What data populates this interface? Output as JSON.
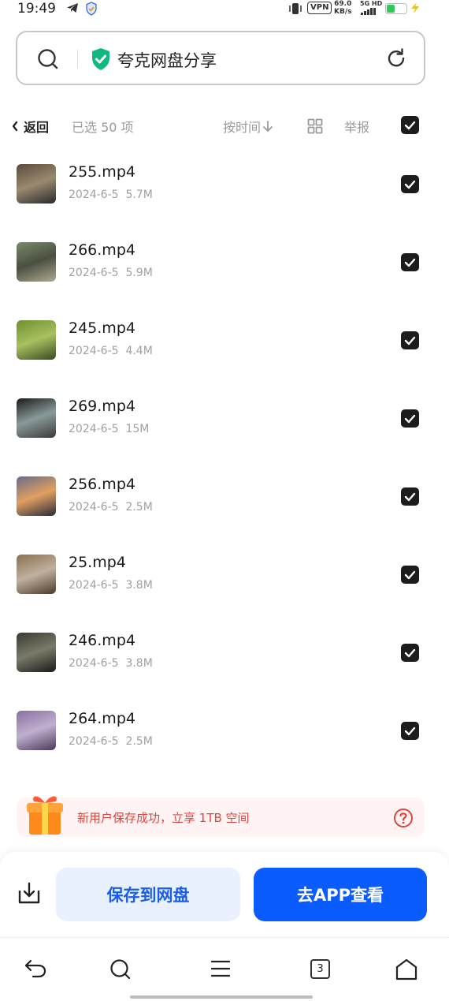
{
  "status_bar": {
    "time": "19:49",
    "vpn": "VPN",
    "speed_value": "69.0",
    "speed_unit": "KB/s",
    "network": "5G HD",
    "battery_level": 0.4
  },
  "search": {
    "text": "夸克网盘分享"
  },
  "toolbar": {
    "back_label": "返回",
    "selected_label": "已选 50 项",
    "sort_label": "按时间",
    "report_label": "举报"
  },
  "files": [
    {
      "name": "255.mp4",
      "date": "2024-6-5",
      "size": "5.7M",
      "thumb_colors": [
        "#5a4a3a",
        "#9a8a70",
        "#2a2a2a"
      ]
    },
    {
      "name": "266.mp4",
      "date": "2024-6-5",
      "size": "5.9M",
      "thumb_colors": [
        "#7a8a6a",
        "#4a5040",
        "#b0a890"
      ]
    },
    {
      "name": "245.mp4",
      "date": "2024-6-5",
      "size": "4.4M",
      "thumb_colors": [
        "#6f8f2f",
        "#a8c060",
        "#3a4a20"
      ]
    },
    {
      "name": "269.mp4",
      "date": "2024-6-5",
      "size": "15M",
      "thumb_colors": [
        "#1a1a1a",
        "#8a9a9a",
        "#3a3a3a"
      ]
    },
    {
      "name": "256.mp4",
      "date": "2024-6-5",
      "size": "2.5M",
      "thumb_colors": [
        "#6a6a8a",
        "#e0a060",
        "#2a2a3a"
      ]
    },
    {
      "name": "25.mp4",
      "date": "2024-6-5",
      "size": "3.8M",
      "thumb_colors": [
        "#8a7050",
        "#c0b0a0",
        "#4a3a2a"
      ]
    },
    {
      "name": "246.mp4",
      "date": "2024-6-5",
      "size": "3.8M",
      "thumb_colors": [
        "#3a3a30",
        "#7a7a6a",
        "#1a1a18"
      ]
    },
    {
      "name": "264.mp4",
      "date": "2024-6-5",
      "size": "2.5M",
      "thumb_colors": [
        "#8a70a0",
        "#c0b0d0",
        "#4a3a5a"
      ]
    }
  ],
  "promo": {
    "text": "新用户保存成功，立享 1TB 空间"
  },
  "actions": {
    "save_label": "保存到网盘",
    "open_app_label": "去APP查看"
  },
  "navbar": {
    "tab_count": "3"
  },
  "colors": {
    "accent": "#0a5cff",
    "save_bg": "#e9f1ff",
    "promo_text": "#e0443e",
    "shield_green": "#10b981"
  }
}
